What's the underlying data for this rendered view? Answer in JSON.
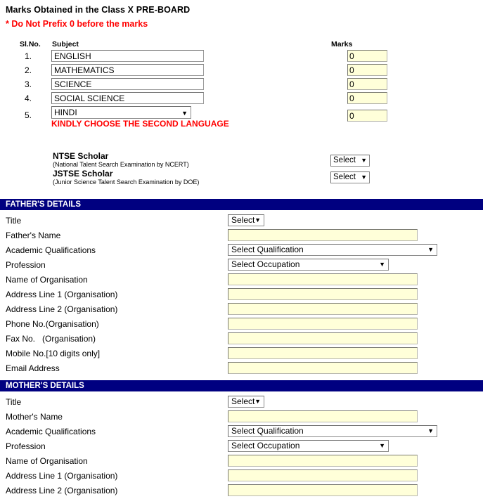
{
  "marks_section": {
    "title": "Marks Obtained in the Class X PRE-BOARD",
    "warning": "* Do Not Prefix 0 before the marks",
    "columns": {
      "slno": "Sl.No.",
      "subject": "Subject",
      "marks": "Marks"
    },
    "rows": [
      {
        "sl": "1.",
        "subject": "ENGLISH",
        "marks": "0",
        "type": "text"
      },
      {
        "sl": "2.",
        "subject": "MATHEMATICS",
        "marks": "0",
        "type": "text"
      },
      {
        "sl": "3.",
        "subject": "SCIENCE",
        "marks": "0",
        "type": "text"
      },
      {
        "sl": "4.",
        "subject": "SOCIAL SCIENCE",
        "marks": "0",
        "type": "text"
      },
      {
        "sl": "5.",
        "subject": "HINDI",
        "marks": "0",
        "type": "select"
      }
    ],
    "language_note": "KINDLY CHOOSE THE SECOND LANGUAGE"
  },
  "scholar_section": {
    "ntse": {
      "title": "NTSE Scholar",
      "subtitle": "(National Talent Search Examination by NCERT)",
      "select_value": "Select"
    },
    "jstse": {
      "title": "JSTSE Scholar",
      "subtitle": "(Junior Science Talent Search Examination by DOE)",
      "select_value": "Select"
    }
  },
  "fathers_details": {
    "heading": "FATHER'S DETAILS",
    "fields": [
      {
        "label": "Title",
        "control": "select",
        "value": "Select",
        "width": "w-title"
      },
      {
        "label": "Father's Name",
        "control": "text",
        "value": ""
      },
      {
        "label": "Academic Qualifications",
        "control": "select",
        "value": "Select Qualification",
        "width": "w-qual"
      },
      {
        "label": "Profession",
        "control": "select",
        "value": "Select Occupation",
        "width": "w-occ"
      },
      {
        "label": "Name of Organisation",
        "control": "text",
        "value": ""
      },
      {
        "label": "Address Line 1 (Organisation)",
        "control": "text",
        "value": ""
      },
      {
        "label": "Address Line 2 (Organisation)",
        "control": "text",
        "value": ""
      },
      {
        "label": "Phone No.(Organisation)",
        "control": "text",
        "value": ""
      },
      {
        "label": "Fax No.   (Organisation)",
        "control": "text",
        "value": ""
      },
      {
        "label": "Mobile No.[10 digits only]",
        "control": "text",
        "value": ""
      },
      {
        "label": "Email Address",
        "control": "text",
        "value": ""
      }
    ]
  },
  "mothers_details": {
    "heading": "MOTHER'S DETAILS",
    "fields": [
      {
        "label": "Title",
        "control": "select",
        "value": "Select",
        "width": "w-title"
      },
      {
        "label": "Mother's Name",
        "control": "text",
        "value": ""
      },
      {
        "label": "Academic Qualifications",
        "control": "select",
        "value": "Select Qualification",
        "width": "w-qual"
      },
      {
        "label": "Profession",
        "control": "select",
        "value": "Select Occupation",
        "width": "w-occ"
      },
      {
        "label": "Name of Organisation",
        "control": "text",
        "value": ""
      },
      {
        "label": "Address Line 1 (Organisation)",
        "control": "text",
        "value": ""
      },
      {
        "label": "Address Line 2 (Organisation)",
        "control": "text",
        "value": ""
      }
    ]
  },
  "icons": {
    "dropdown_arrow": "▼"
  },
  "colors": {
    "section_bar": "#000080",
    "input_fill": "#ffffd9",
    "warning": "#ff0000"
  }
}
